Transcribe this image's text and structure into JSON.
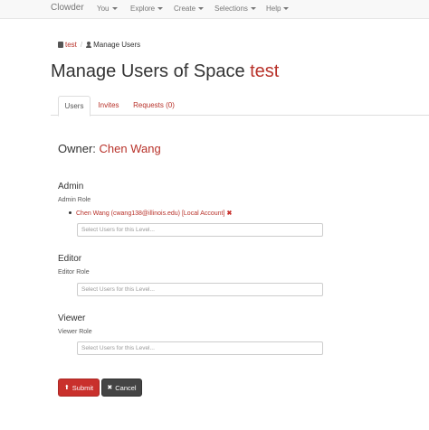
{
  "navbar": {
    "brand": "Clowder",
    "items": [
      {
        "label": "You"
      },
      {
        "label": "Explore"
      },
      {
        "label": "Create"
      },
      {
        "label": "Selections"
      },
      {
        "label": "Help"
      }
    ]
  },
  "breadcrumb": {
    "space": "test",
    "separator": "/",
    "current": "Manage Users"
  },
  "title": {
    "prefix": "Manage Users of Space",
    "space": "test"
  },
  "tabs": [
    {
      "label": "Users",
      "active": true
    },
    {
      "label": "Invites",
      "active": false
    },
    {
      "label": "Requests (0)",
      "active": false
    }
  ],
  "owner": {
    "label": "Owner:",
    "name": "Chen Wang"
  },
  "roles": {
    "admin": {
      "title": "Admin",
      "subtitle": "Admin Role",
      "members": [
        "Chen Wang (cwang138@illinois.edu) [Local Account]"
      ],
      "placeholder": "Select Users for this Level..."
    },
    "editor": {
      "title": "Editor",
      "subtitle": "Editor Role",
      "placeholder": "Select Users for this Level..."
    },
    "viewer": {
      "title": "Viewer",
      "subtitle": "Viewer Role",
      "placeholder": "Select Users for this Level..."
    }
  },
  "buttons": {
    "submit": "Submit",
    "cancel": "Cancel"
  },
  "colors": {
    "accent": "#b8322a",
    "submit_bg": "#c9302c",
    "cancel_bg": "#444444"
  }
}
